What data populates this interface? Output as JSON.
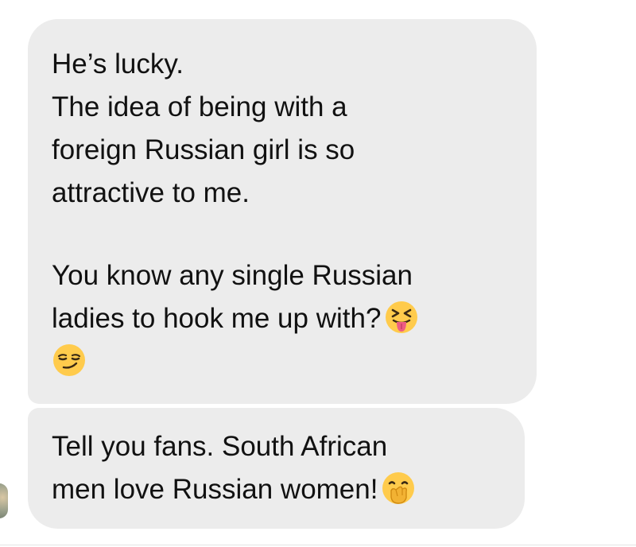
{
  "messages": [
    {
      "lines": [
        "He’s lucky.",
        "The idea of being with a",
        "foreign Russian girl is so",
        "attractive to me.",
        "",
        "You know any single Russian",
        "ladies to hook me up with?"
      ],
      "emojis": [
        "squinting-tongue-emoji",
        "smirking-face-emoji"
      ]
    },
    {
      "lines": [
        "Tell you fans. South African",
        "men love Russian women!"
      ],
      "emojis": [
        "face-with-hand-over-mouth-emoji"
      ]
    }
  ],
  "colors": {
    "bubble_background": "#ececec",
    "text": "#111111",
    "emoji_yellow": "#ffcb4c"
  }
}
